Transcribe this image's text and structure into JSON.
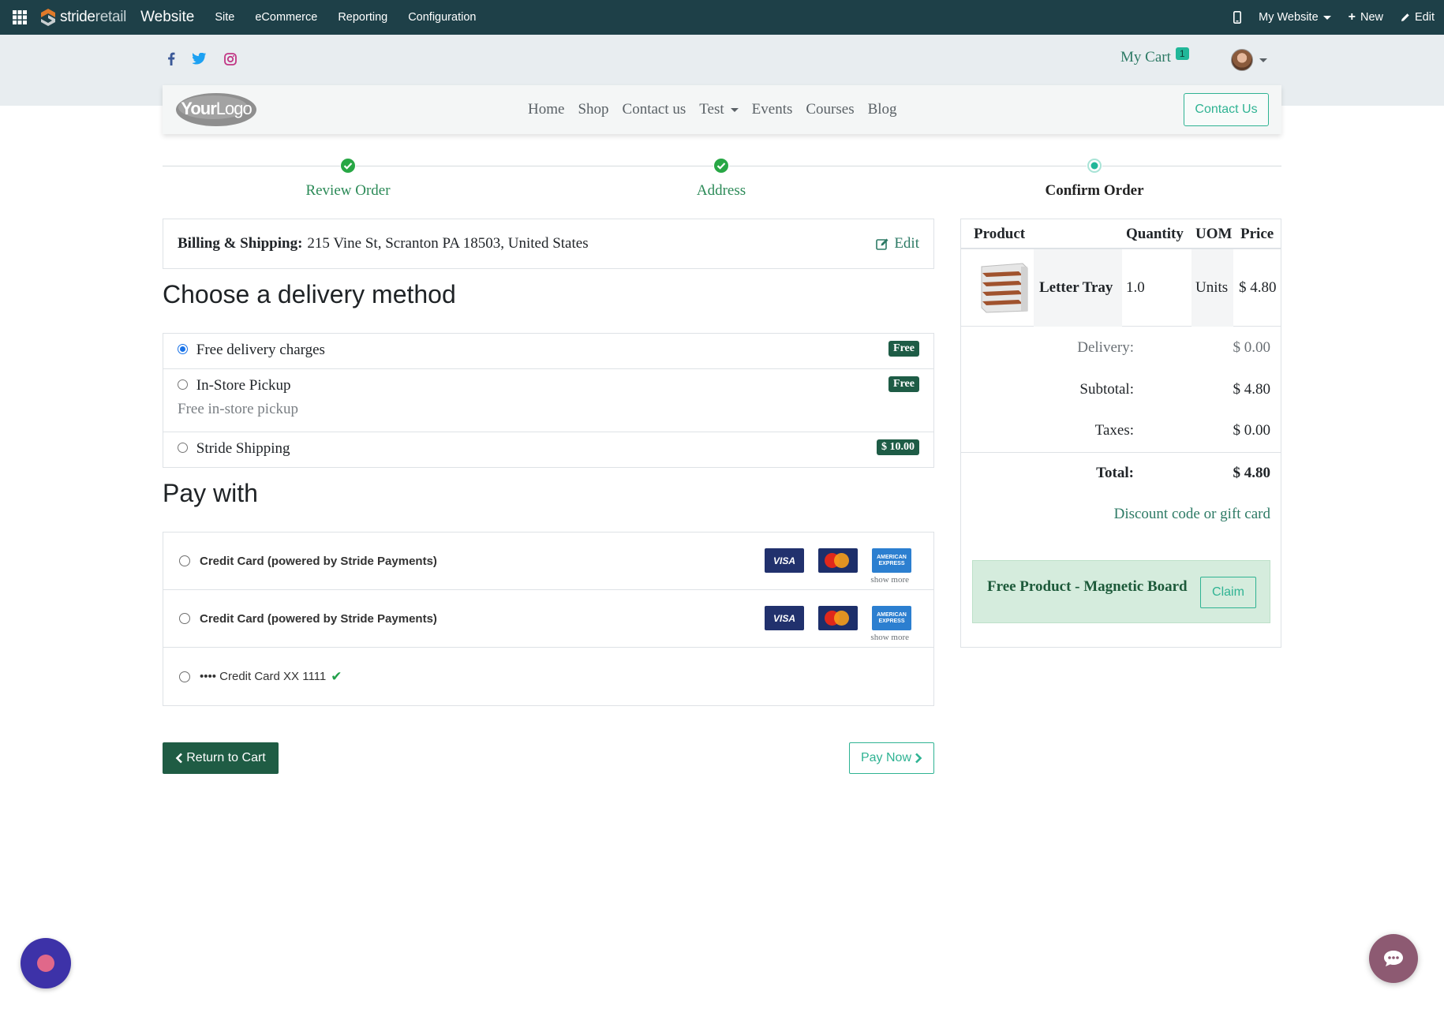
{
  "adminbar": {
    "brand_strong": "stride",
    "brand_light": "retail",
    "app": "Website",
    "menus": [
      "Site",
      "eCommerce",
      "Reporting",
      "Configuration"
    ],
    "my_website": "My Website",
    "new": "New",
    "edit": "Edit"
  },
  "header": {
    "social": [
      "facebook-icon",
      "twitter-icon",
      "instagram-icon"
    ],
    "cart_label": "My Cart",
    "cart_count": "1"
  },
  "navbar": {
    "logo_text": "YourLogo",
    "links": [
      "Home",
      "Shop",
      "Contact us",
      "Test",
      "Events",
      "Courses",
      "Blog"
    ],
    "contact_button": "Contact Us"
  },
  "steps": [
    {
      "label": "Review Order",
      "state": "done"
    },
    {
      "label": "Address",
      "state": "done"
    },
    {
      "label": "Confirm Order",
      "state": "current"
    }
  ],
  "billing": {
    "label": "Billing & Shipping:",
    "address": "215 Vine St, Scranton PA 18503, United States",
    "edit": "Edit"
  },
  "delivery": {
    "title": "Choose a delivery method",
    "options": [
      {
        "label": "Free delivery charges",
        "price": "Free",
        "selected": true
      },
      {
        "label": "In-Store Pickup",
        "price": "Free",
        "description": "Free in-store pickup"
      },
      {
        "label": "Stride Shipping",
        "price": "$ 10.00"
      }
    ]
  },
  "payment": {
    "title": "Pay with",
    "options": [
      {
        "label": "Credit Card (powered by Stride Payments)",
        "show_more": "show more"
      },
      {
        "label": "Credit Card (powered by Stride Payments)",
        "show_more": "show more"
      },
      {
        "label": "•••• Credit Card XX 1111"
      }
    ],
    "card_brands": {
      "visa": "VISA",
      "mastercard": "MasterCard",
      "amex": "AMERICAN EXPRESS"
    }
  },
  "buttons": {
    "return_to_cart": "Return to Cart",
    "pay_now": "Pay Now"
  },
  "summary": {
    "headers": {
      "product": "Product",
      "quantity": "Quantity",
      "uom": "UOM",
      "price": "Price"
    },
    "line": {
      "name": "Letter Tray",
      "quantity": "1.0",
      "uom": "Units",
      "price": "$ 4.80"
    },
    "totals": [
      {
        "label": "Delivery:",
        "value": "$ 0.00"
      },
      {
        "label": "Subtotal:",
        "value": "$ 4.80"
      },
      {
        "label": "Taxes:",
        "value": "$ 0.00"
      },
      {
        "label": "Total:",
        "value": "$ 4.80"
      }
    ],
    "discount_link": "Discount code or gift card",
    "promo_text": "Free Product - Magnetic Board",
    "claim": "Claim"
  },
  "colors": {
    "adminbar_bg": "#1e4048",
    "accent": "#2fb393",
    "primary_dark": "#1f5c44",
    "link": "#2d7a65"
  }
}
